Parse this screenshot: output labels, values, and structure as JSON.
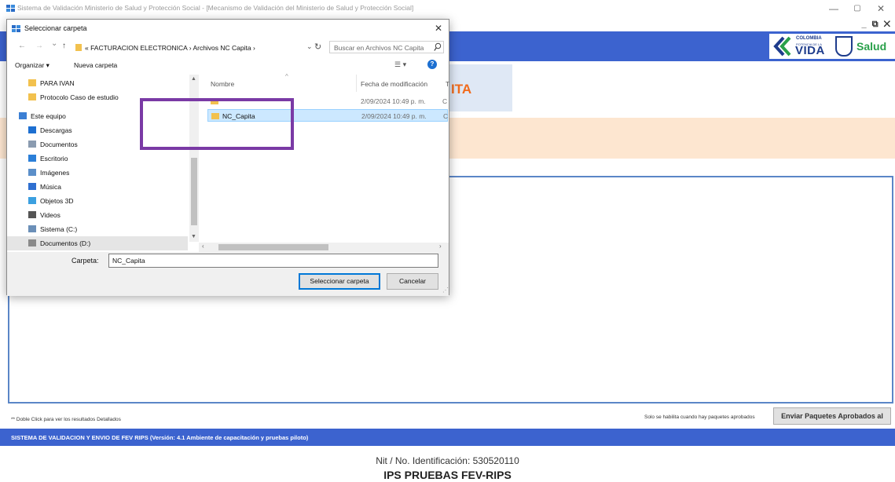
{
  "window": {
    "title": "Sistema de Validación Ministerio de Salud y Protección Social - [Mecanismo de Validación del Ministerio de Salud y Protección Social]",
    "minimize": "—",
    "maximize": "▢",
    "close": "✕",
    "mdi_controls": "_ ⧉ ✕"
  },
  "brand": {
    "colombia": "COLOMBIA",
    "potencia": "POTENCIA DE LA",
    "vida": "VIDA",
    "salud": "Salud",
    "colors": {
      "header_blue": "#3c63cf",
      "vida_blue": "#1e3c8c",
      "salud_green": "#2aa04a"
    }
  },
  "main": {
    "title_fragment": "ITA",
    "title_color": "#f16b1c",
    "hint_left": "** Doble Click para ver los resultados Detallados",
    "hint_right": "Solo se habilita cuando hay paquetes aprobados",
    "send_button": "Enviar Paquetes Aprobados al"
  },
  "footer": {
    "banner": "SISTEMA DE VALIDACION Y ENVIO DE FEV RIPS  (Versión: 4.1 Ambiente de capacitación y pruebas piloto)",
    "nit": "Nit / No. Identificación: 530520110",
    "ips": "IPS PRUEBAS FEV-RIPS"
  },
  "dialog": {
    "title": "Seleccionar carpeta",
    "close": "✕",
    "nav": {
      "back": "←",
      "forward": "→",
      "recent": "⌄",
      "up": "↑"
    },
    "address": "« FACTURACION ELECTRONICA  ›  Archivos NC Capita  ›",
    "address_dropdown": "⌄",
    "refresh": "↻",
    "search_placeholder": "Buscar en Archivos NC Capita",
    "toolbar": {
      "organize": "Organizar ▾",
      "new_folder": "Nueva carpeta",
      "view": "☰ ▾",
      "help": "?"
    },
    "nav_pane": [
      {
        "label": "PARA IVAN",
        "icon": "folder-icon",
        "color": "#f2c14e"
      },
      {
        "label": "Protocolo Caso de estudio",
        "icon": "folder-icon",
        "color": "#f2c14e"
      },
      {
        "label": "Este equipo",
        "icon": "computer-icon",
        "color": "#3b7fd4"
      },
      {
        "label": "Descargas",
        "icon": "download-icon",
        "color": "#1d6fd1"
      },
      {
        "label": "Documentos",
        "icon": "documents-icon",
        "color": "#8a9bb0"
      },
      {
        "label": "Escritorio",
        "icon": "desktop-icon",
        "color": "#2b7fd8"
      },
      {
        "label": "Imágenes",
        "icon": "pictures-icon",
        "color": "#5b8fc9"
      },
      {
        "label": "Música",
        "icon": "music-icon",
        "color": "#2f6fd0"
      },
      {
        "label": "Objetos 3D",
        "icon": "objects-3d-icon",
        "color": "#3ba0e0"
      },
      {
        "label": "Videos",
        "icon": "videos-icon",
        "color": "#555555"
      },
      {
        "label": "Sistema (C:)",
        "icon": "drive-icon",
        "color": "#6b8fb8"
      },
      {
        "label": "Documentos (D:)",
        "icon": "drive-icon",
        "color": "#8a8a8a"
      }
    ],
    "columns": {
      "name": "Nombre",
      "date": "Fecha de modificación",
      "truncated": "T"
    },
    "files": [
      {
        "name": "",
        "date": "2/09/2024 10:49 p. m.",
        "type_frag": "C"
      },
      {
        "name": "NC_Capita",
        "date": "2/09/2024 10:49 p. m.",
        "type_frag": "C"
      }
    ],
    "folder_label": "Carpeta:",
    "folder_value": "NC_Capita",
    "select_button": "Seleccionar carpeta",
    "cancel_button": "Cancelar"
  }
}
